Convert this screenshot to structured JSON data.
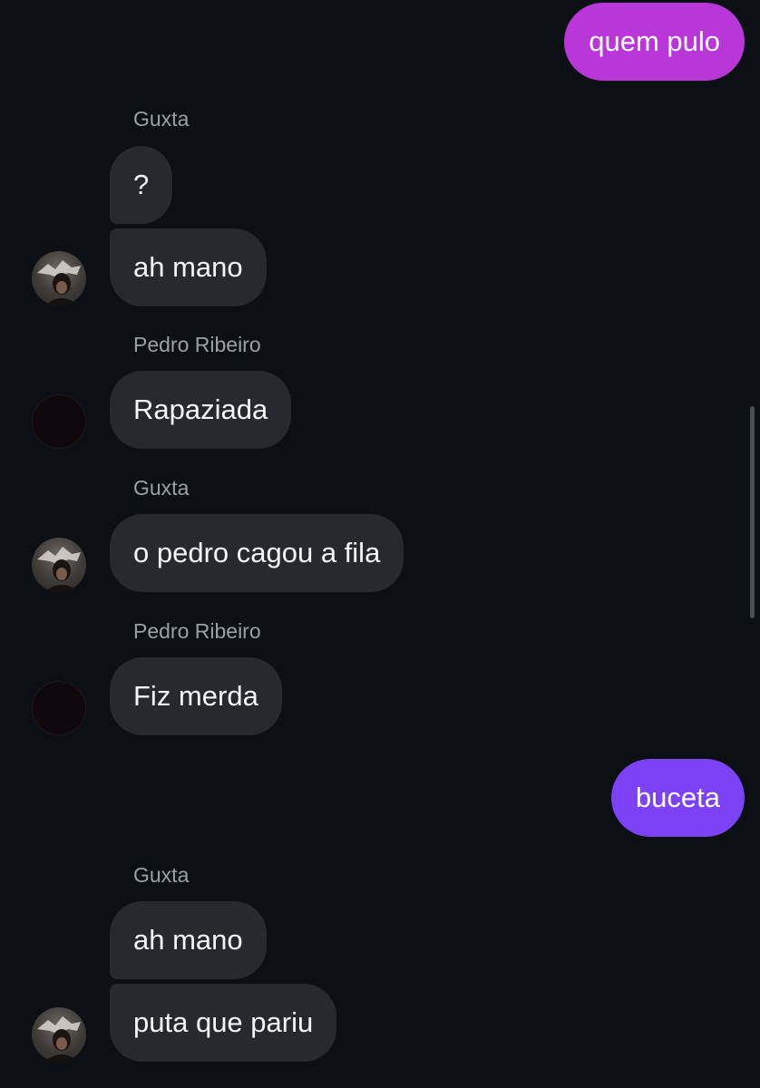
{
  "colors": {
    "background": "#0c1014",
    "incoming_bubble": "#262a2f",
    "outgoing_bubble_1": "#b936d9",
    "outgoing_bubble_2": "#7c42f5",
    "sender_name": "#9aa0a8"
  },
  "messages": [
    {
      "direction": "out",
      "text": "quem pulo"
    },
    {
      "direction": "in",
      "sender": "Guxta",
      "text": "?"
    },
    {
      "direction": "in",
      "sender": "Guxta",
      "text": "ah mano"
    },
    {
      "direction": "in",
      "sender": "Pedro Ribeiro",
      "text": "Rapaziada"
    },
    {
      "direction": "in",
      "sender": "Guxta",
      "text": "o pedro cagou a fila"
    },
    {
      "direction": "in",
      "sender": "Pedro Ribeiro",
      "text": "Fiz merda"
    },
    {
      "direction": "out",
      "text": "buceta"
    },
    {
      "direction": "in",
      "sender": "Guxta",
      "text": "ah mano"
    },
    {
      "direction": "in",
      "sender": "Guxta",
      "text": "puta que pariu"
    }
  ]
}
